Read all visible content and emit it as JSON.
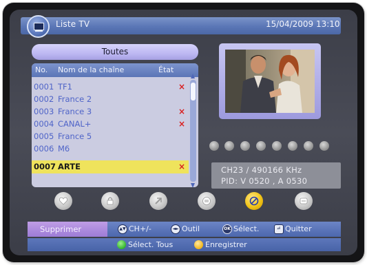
{
  "header": {
    "title": "Liste TV",
    "datetime": "15/04/2009 13:10",
    "icon": "tv-icon"
  },
  "group": {
    "label": "Toutes"
  },
  "list": {
    "columns": {
      "no": "No.",
      "name": "Nom de la chaîne",
      "state": "État"
    },
    "rows": [
      {
        "no": "0001",
        "name": "TF1",
        "mark": "×"
      },
      {
        "no": "0002",
        "name": "France 2",
        "mark": ""
      },
      {
        "no": "0003",
        "name": "France 3",
        "mark": "×"
      },
      {
        "no": "0004",
        "name": "CANAL+",
        "mark": "×"
      },
      {
        "no": "0005",
        "name": "France 5",
        "mark": ""
      },
      {
        "no": "0006",
        "name": "M6",
        "mark": ""
      },
      {
        "no": "0007",
        "name": "ARTE",
        "mark": "×"
      }
    ],
    "selected_index": 6
  },
  "preview": {
    "icon": "video-preview"
  },
  "signal": {
    "dots": 8
  },
  "channel_info": {
    "line1": "CH23 / 490166 KHz",
    "line2": "PID: V 0520 , A 0530"
  },
  "tools": [
    {
      "name": "favorite-icon"
    },
    {
      "name": "lock-icon"
    },
    {
      "name": "skip-icon"
    },
    {
      "name": "move-icon"
    },
    {
      "name": "delete-icon",
      "active": true
    },
    {
      "name": "rename-icon"
    }
  ],
  "footer": {
    "delete_label": "Supprimer",
    "ch_label": "CH+/-",
    "tool_label": "Outil",
    "select_label": "Sélect.",
    "ok_label": "OK",
    "quit_label": "Quitter",
    "select_all_label": "Sélect. Tous",
    "save_label": "Enregistrer"
  },
  "colors": {
    "accent_blue": "#5a76b6",
    "selection": "#efe35c",
    "delete_mark": "#d92020"
  }
}
